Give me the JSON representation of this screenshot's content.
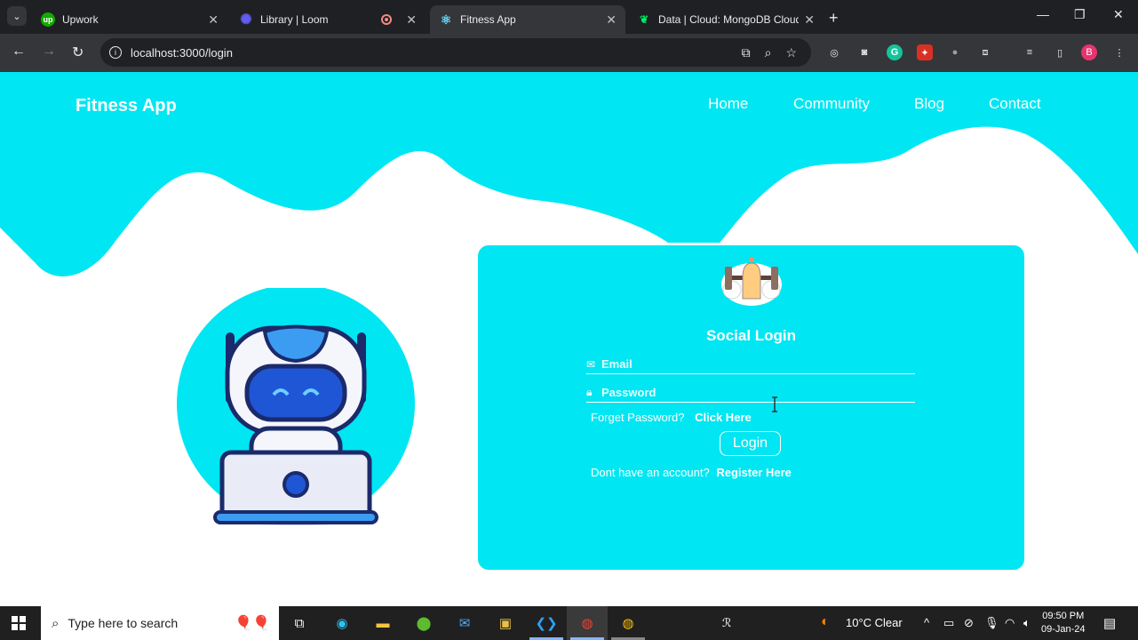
{
  "browser": {
    "tabs": [
      {
        "title": "Upwork",
        "favicon": "upwork-icon",
        "color": "#14a800",
        "active": false
      },
      {
        "title": "Library | Loom",
        "favicon": "loom-icon",
        "color": "#625df5",
        "active": false
      },
      {
        "title": "Fitness App",
        "favicon": "react-icon",
        "color": "#61dafb",
        "active": true
      },
      {
        "title": "Data | Cloud: MongoDB Cloud",
        "favicon": "mongodb-leaf-icon",
        "color": "#00ed64",
        "active": false
      }
    ],
    "url": "localhost:3000/login",
    "profile_initial": "B"
  },
  "page": {
    "brand": "Fitness App",
    "nav": [
      "Home",
      "Community",
      "Blog",
      "Contact"
    ],
    "accent_color": "#00e6f2",
    "login": {
      "title": "Social Login",
      "email_placeholder": "Email",
      "password_placeholder": "Password",
      "forgot_text": "Forget Password?",
      "forgot_link": "Click Here",
      "login_button": "Login",
      "register_text": "Dont have an account?",
      "register_link": "Register Here"
    }
  },
  "taskbar": {
    "search_placeholder": "Type here to search",
    "weather": "10°C  Clear",
    "time": "09:50 PM",
    "date": "09-Jan-24"
  }
}
